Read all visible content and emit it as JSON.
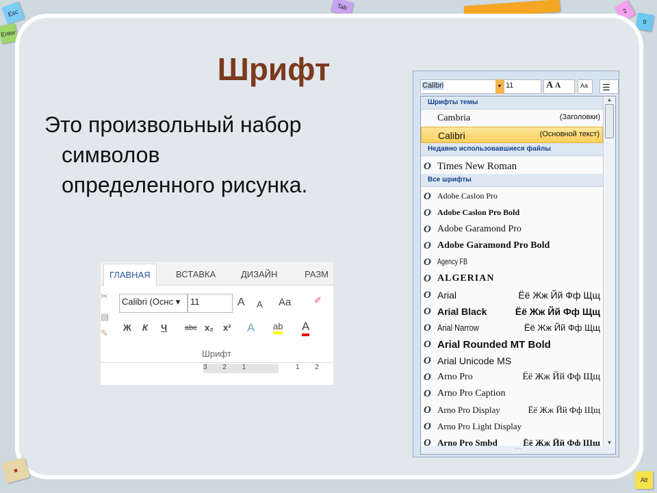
{
  "keys": [
    "Esc",
    "Tab",
    "Enter",
    "2",
    "9",
    "Alt"
  ],
  "slide": {
    "title": "Шрифт",
    "body": [
      "Это произвольный набор",
      "символов",
      "определенного рисунка."
    ]
  },
  "word2013": {
    "tabs": [
      "ГЛАВНАЯ",
      "ВСТАВКА",
      "ДИЗАЙН",
      "РАЗМ"
    ],
    "font": "Calibri (Оснс",
    "size": "11",
    "grow": "A",
    "shrink": "A",
    "case": "Aa",
    "bold": "Ж",
    "italic": "К",
    "underline": "Ч",
    "strike": "abc",
    "sub": "x₂",
    "sup": "x²",
    "group": "Шрифт",
    "ruler": [
      "3",
      "2",
      "1",
      "1",
      "2"
    ],
    "highlight_color": "#ffff00",
    "font_color": "#e00000"
  },
  "word2007": {
    "font": "Calibri",
    "size": "11",
    "theme_header": "Шрифты темы",
    "theme": [
      {
        "name": "Cambria",
        "note": "(Заголовки)"
      },
      {
        "name": "Calibri",
        "note": "(Основной текст)"
      }
    ],
    "recent_header": "Недавно использовавшиеся файлы",
    "recent": "Times New Roman",
    "all_header": "Все шрифты",
    "fonts": [
      {
        "name": "Adobe Caslon Pro",
        "sample": ""
      },
      {
        "name": "Adobe Caslon Pro Bold",
        "sample": ""
      },
      {
        "name": "Adobe Garamond Pro",
        "sample": ""
      },
      {
        "name": "Adobe Garamond Pro Bold",
        "sample": ""
      },
      {
        "name": "Agency FB",
        "sample": ""
      },
      {
        "name": "ALGERIAN",
        "sample": ""
      },
      {
        "name": "Arial",
        "sample": "Ёё Жж Йй Фф Щщ"
      },
      {
        "name": "Arial Black",
        "sample": "Ёё Жж Йй Фф Щщ"
      },
      {
        "name": "Arial Narrow",
        "sample": "Ёё Жж Йй Фф Щщ"
      },
      {
        "name": "Arial Rounded MT Bold",
        "sample": ""
      },
      {
        "name": "Arial Unicode MS",
        "sample": ""
      },
      {
        "name": "Arno Pro",
        "sample": "Ёё Жж Йй Фф Щщ"
      },
      {
        "name": "Arno Pro Caption",
        "sample": ""
      },
      {
        "name": "Arno Pro Display",
        "sample": "Ёё Жж Йй Фф Щщ"
      },
      {
        "name": "Arno Pro Light Display",
        "sample": ""
      },
      {
        "name": "Arno Pro Smbd",
        "sample": "Ёё Жж Йй Фф Щщ"
      }
    ],
    "selected_color": "#fcd46b"
  }
}
